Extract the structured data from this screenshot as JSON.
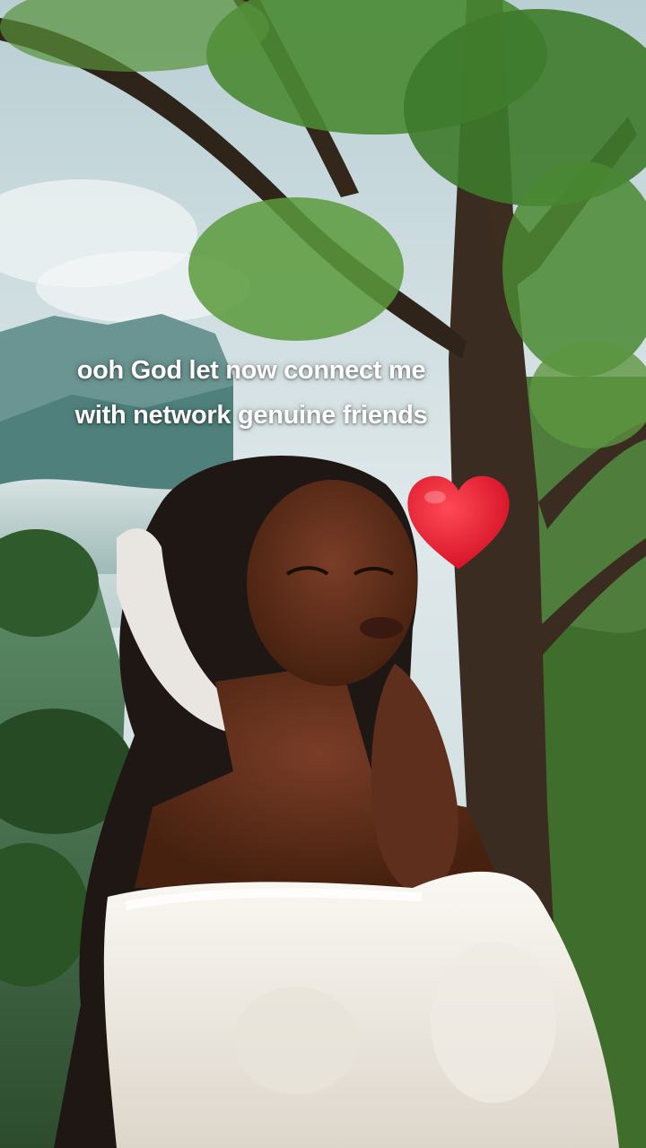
{
  "caption": {
    "line1": "ooh God let now connect me",
    "line2": "with network genuine friends"
  },
  "icons": {
    "heart": "red-heart-icon"
  },
  "colors": {
    "sky": "#cfe0e4",
    "mountain": "#5d8a86",
    "mist": "#dfe9ea",
    "foliage": "#3f7a2f",
    "trunk": "#3a2c20",
    "skin": "#5a2e1f",
    "hair": "#1e1714",
    "blouse": "#f2efe9",
    "heart": "#e0122a"
  }
}
